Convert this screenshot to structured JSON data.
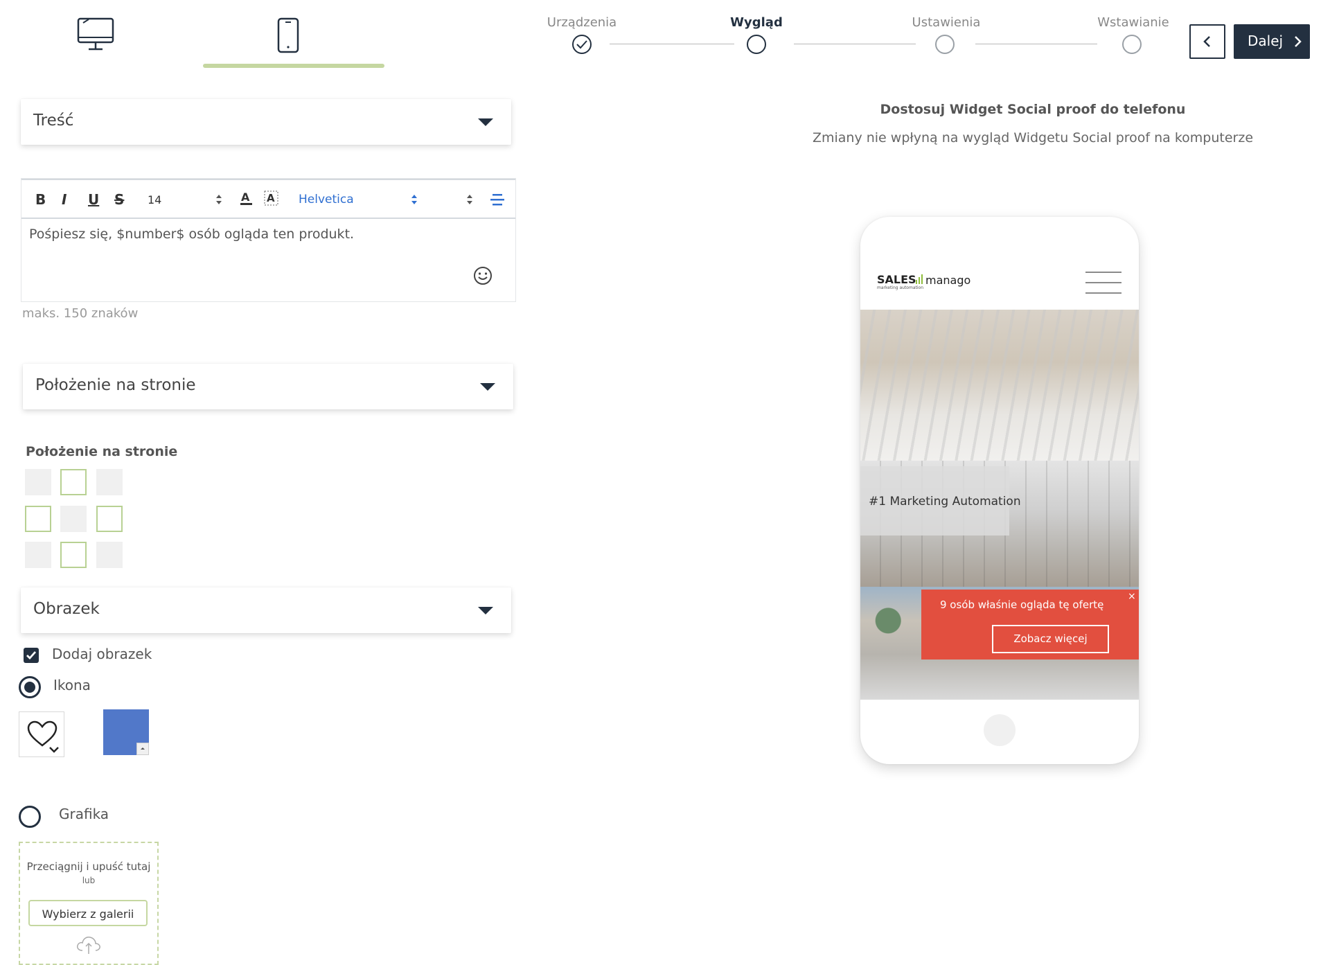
{
  "devices": {
    "desktop_icon": "desktop-icon",
    "mobile_icon": "mobile-icon",
    "active": "mobile"
  },
  "stepper": {
    "steps": [
      {
        "label": "Urządzenia",
        "state": "done"
      },
      {
        "label": "Wygląd",
        "state": "active"
      },
      {
        "label": "Ustawienia",
        "state": "pending"
      },
      {
        "label": "Wstawianie",
        "state": "pending"
      }
    ],
    "back_icon": "chevron-left-icon",
    "next_label": "Dalej",
    "next_icon": "chevron-right-icon"
  },
  "content_section": {
    "title": "Treść",
    "toolbar": {
      "bold": "B",
      "italic": "I",
      "underline": "U",
      "strike": "S",
      "font_size": "14",
      "font_family": "Helvetica"
    },
    "text": "Pośpiesz się, $number$ osób ogląda ten produkt.",
    "emoji_icon": "smiley-icon",
    "helper": "maks. 150 znaków"
  },
  "position_section": {
    "title": "Położenie na stronie",
    "label": "Położenie na stronie"
  },
  "image_section": {
    "title": "Obrazek",
    "add_image_label": "Dodaj obrazek",
    "add_image_checked": true,
    "icon_option_label": "Ikona",
    "graphic_option_label": "Grafika",
    "selected_option": "Ikona",
    "selected_icon": "heart-icon",
    "icon_color": "#5178c9",
    "dropzone_text": "Przeciągnij i upuść tutaj",
    "dropzone_or": "lub",
    "gallery_button": "Wybierz z galerii",
    "upload_icon": "cloud-upload-icon"
  },
  "preview": {
    "heading": "Dostosuj Widget Social proof do telefonu",
    "subheading": "Zmiany nie wpłyną na wygląd Widgetu Social proof na komputerze",
    "logo_text_1": "SALES",
    "logo_text_2": "manago",
    "logo_tagline": "marketing automation",
    "hero_label": "#1 Marketing Automation",
    "popup_text": "9 osób  właśnie ogląda tę ofertę",
    "popup_button": "Zobacz więcej",
    "popup_close": "×",
    "popup_color": "#e24f3f"
  }
}
